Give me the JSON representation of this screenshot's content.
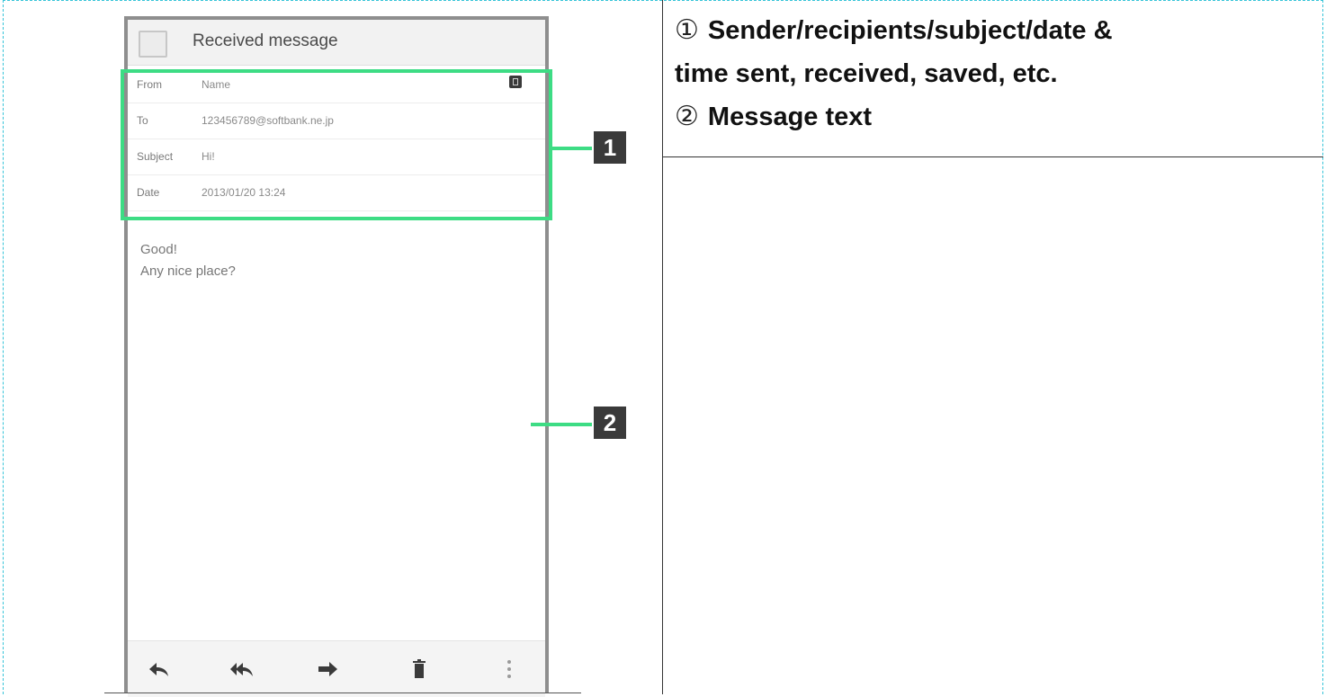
{
  "phone": {
    "header_title": "Received message",
    "info_rows": [
      {
        "label": "From",
        "value": "Name"
      },
      {
        "label": "To",
        "value": "123456789@softbank.ne.jp"
      },
      {
        "label": "Subject",
        "value": "Hi!"
      },
      {
        "label": "Date",
        "value": "2013/01/20 13:24"
      }
    ],
    "body_lines": [
      "Good!",
      "Any nice place?"
    ],
    "toolbar_icons": [
      "reply-icon",
      "reply-all-icon",
      "forward-icon",
      "delete-icon",
      "more-icon"
    ]
  },
  "callouts": {
    "one": "1",
    "two": "2"
  },
  "descriptions": {
    "item1_num": "①",
    "item1_line1": "Sender/recipients/subject/date &",
    "item1_line2": "time sent, received, saved, etc.",
    "item2_num": "②",
    "item2_text": "Message text"
  },
  "colors": {
    "highlight": "#3ddc84",
    "callout_bg": "#3a3a3a",
    "table_border": "#35c4d8"
  }
}
